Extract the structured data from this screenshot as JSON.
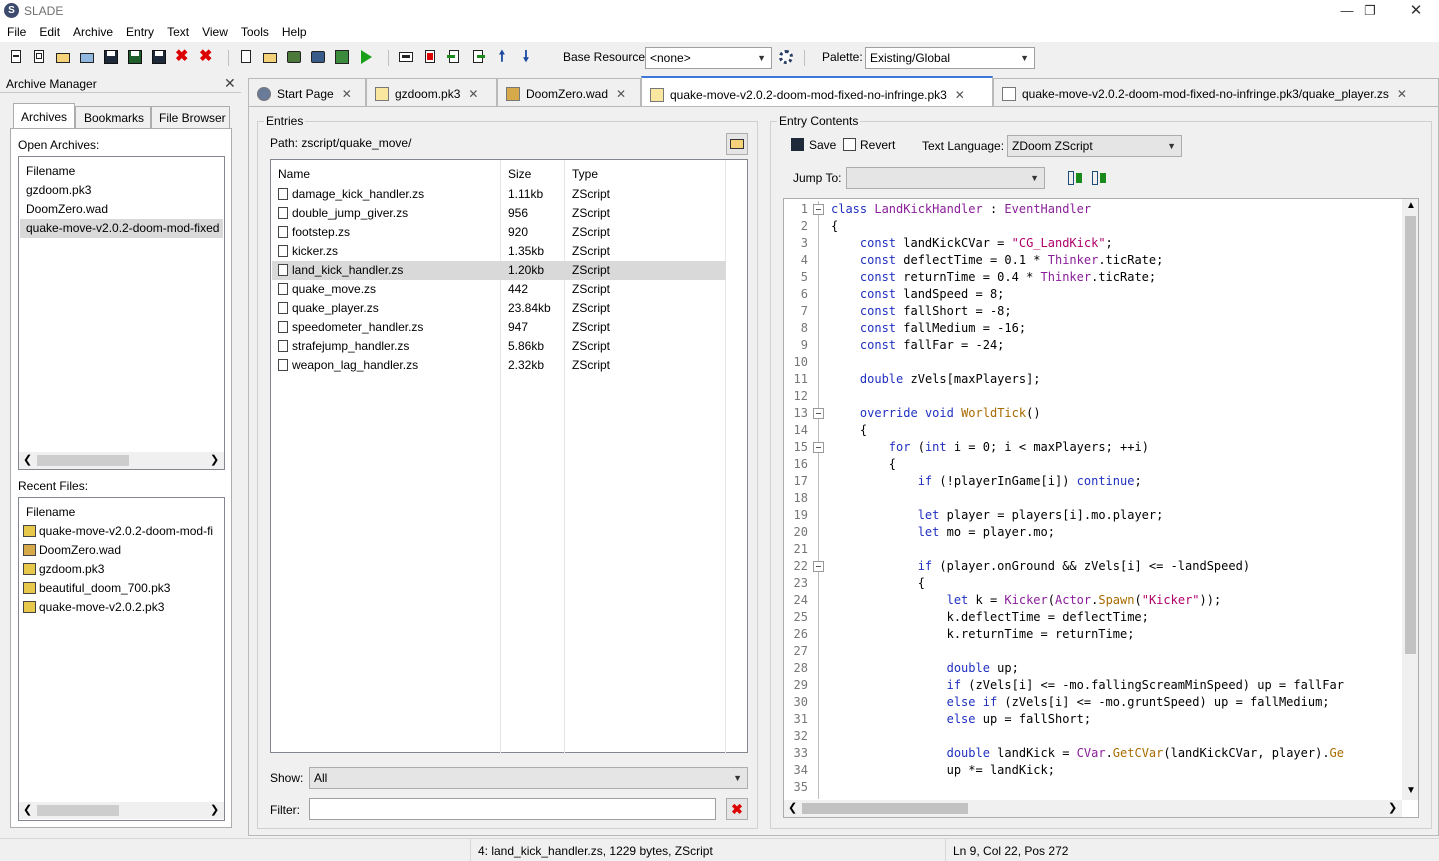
{
  "window": {
    "title": "SLADE",
    "logo": "S"
  },
  "menu": [
    "File",
    "Edit",
    "Archive",
    "Entry",
    "Text",
    "View",
    "Tools",
    "Help"
  ],
  "toolbar": {
    "base_resource_label": "Base Resource:",
    "base_resource_value": "<none>",
    "palette_label": "Palette:",
    "palette_value": "Existing/Global"
  },
  "archive_manager": {
    "title": "Archive Manager",
    "tabs": [
      "Archives",
      "Bookmarks",
      "File Browser"
    ],
    "open_label": "Open Archives:",
    "col_filename": "Filename",
    "open_archives": [
      "gzdoom.pk3",
      "DoomZero.wad",
      "quake-move-v2.0.2-doom-mod-fixed"
    ],
    "recent_label": "Recent Files:",
    "recent_files": [
      {
        "name": "quake-move-v2.0.2-doom-mod-fi",
        "icon": "zip-icon"
      },
      {
        "name": "DoomZero.wad",
        "icon": "wad-icon"
      },
      {
        "name": "gzdoom.pk3",
        "icon": "zip-icon"
      },
      {
        "name": "beautiful_doom_700.pk3",
        "icon": "zip-icon"
      },
      {
        "name": "quake-move-v2.0.2.pk3",
        "icon": "zip-icon"
      }
    ]
  },
  "doc_tabs": [
    {
      "label": "Start Page"
    },
    {
      "label": "gzdoom.pk3"
    },
    {
      "label": "DoomZero.wad"
    },
    {
      "label": "quake-move-v2.0.2-doom-mod-fixed-no-infringe.pk3"
    },
    {
      "label": "quake-move-v2.0.2-doom-mod-fixed-no-infringe.pk3/quake_player.zs"
    }
  ],
  "entries": {
    "title": "Entries",
    "path": "Path: zscript/quake_move/",
    "columns": [
      "Name",
      "Size",
      "Type"
    ],
    "rows": [
      [
        "damage_kick_handler.zs",
        "1.11kb",
        "ZScript"
      ],
      [
        "double_jump_giver.zs",
        "956",
        "ZScript"
      ],
      [
        "footstep.zs",
        "920",
        "ZScript"
      ],
      [
        "kicker.zs",
        "1.35kb",
        "ZScript"
      ],
      [
        "land_kick_handler.zs",
        "1.20kb",
        "ZScript"
      ],
      [
        "quake_move.zs",
        "442",
        "ZScript"
      ],
      [
        "quake_player.zs",
        "23.84kb",
        "ZScript"
      ],
      [
        "speedometer_handler.zs",
        "947",
        "ZScript"
      ],
      [
        "strafejump_handler.zs",
        "5.86kb",
        "ZScript"
      ],
      [
        "weapon_lag_handler.zs",
        "2.32kb",
        "ZScript"
      ]
    ],
    "selected_index": 4,
    "show_label": "Show:",
    "show_value": "All",
    "filter_label": "Filter:",
    "filter_value": ""
  },
  "entry_contents": {
    "title": "Entry Contents",
    "save": "Save",
    "revert": "Revert",
    "text_language_label": "Text Language:",
    "text_language_value": "ZDoom ZScript",
    "jump_to_label": "Jump To:",
    "jump_to_value": "",
    "fold_lines": [
      1,
      13,
      15,
      22
    ],
    "lines": [
      "class LandKickHandler : EventHandler",
      "{",
      "    const landKickCVar = \"CG_LandKick\";",
      "    const deflectTime = 0.1 * Thinker.ticRate;",
      "    const returnTime = 0.4 * Thinker.ticRate;",
      "    const landSpeed = 8;",
      "    const fallShort = -8;",
      "    const fallMedium = -16;",
      "    const fallFar = -24;",
      "",
      "    double zVels[maxPlayers];",
      "",
      "    override void WorldTick()",
      "    {",
      "        for (int i = 0; i < maxPlayers; ++i)",
      "        {",
      "            if (!playerInGame[i]) continue;",
      "",
      "            let player = players[i].mo.player;",
      "            let mo = player.mo;",
      "",
      "            if (player.onGround && zVels[i] <= -landSpeed)",
      "            {",
      "                let k = Kicker(Actor.Spawn(\"Kicker\"));",
      "                k.deflectTime = deflectTime;",
      "                k.returnTime = returnTime;",
      "",
      "                double up;",
      "                if (zVels[i] <= -mo.fallingScreamMinSpeed) up = fallFar",
      "                else if (zVels[i] <= -mo.gruntSpeed) up = fallMedium;",
      "                else up = fallShort;",
      "",
      "                double landKick = CVar.GetCVar(landKickCVar, player).Ge",
      "                up *= landKick;",
      ""
    ]
  },
  "status": {
    "entry": "4: land_kick_handler.zs, 1229 bytes, ZScript",
    "position": "Ln 9, Col 22, Pos 272"
  }
}
